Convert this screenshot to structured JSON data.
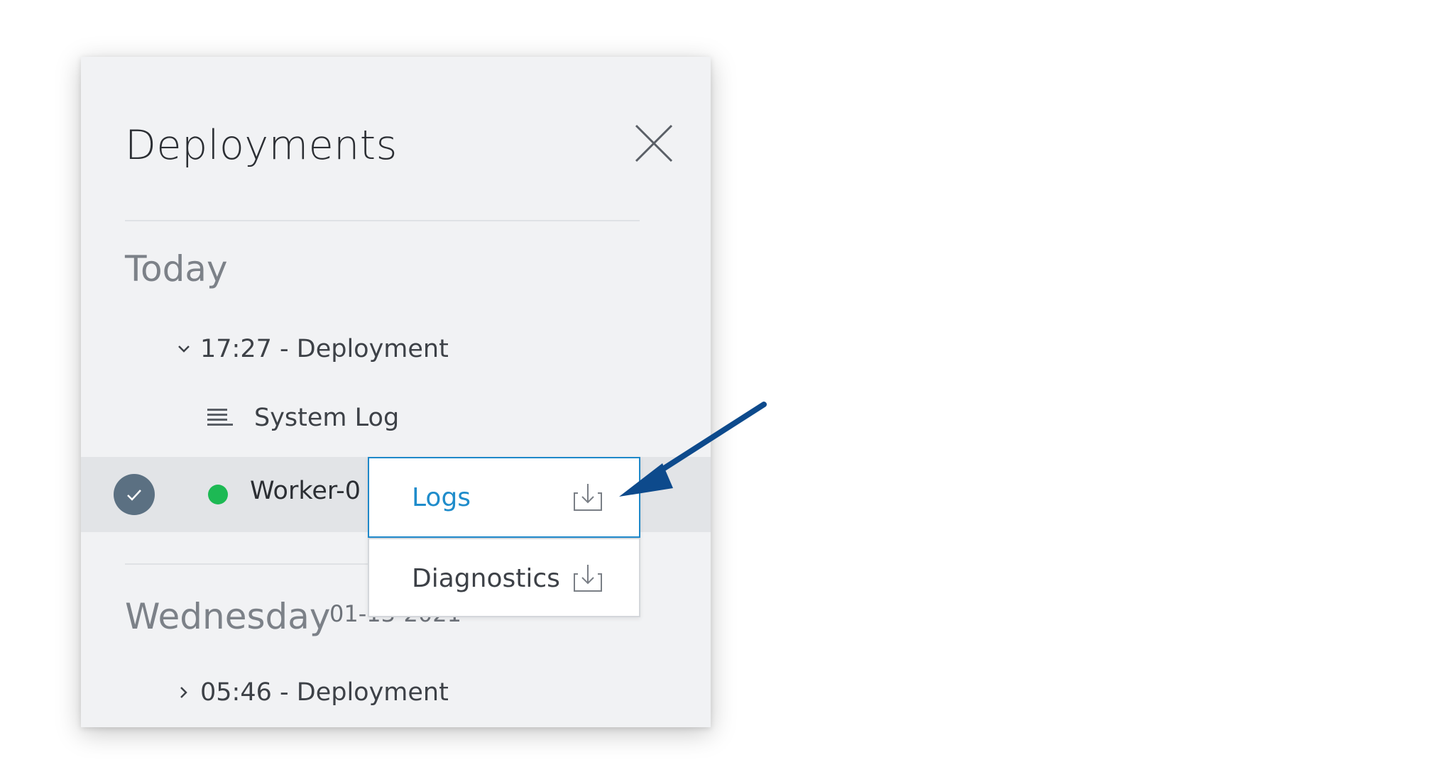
{
  "panel": {
    "title": "Deployments",
    "close_icon": "close-icon"
  },
  "sections": {
    "today": {
      "label": "Today",
      "deployment_label": "17:27 - Deployment",
      "deployment_icon": "chevron-down-icon",
      "system_log_label": "System Log",
      "system_log_icon": "lines-icon",
      "worker": {
        "label": "Worker-0",
        "status_color": "#1db954",
        "check_icon": "check-icon"
      }
    },
    "wednesday": {
      "label": "Wednesday",
      "date": "01-13-2021",
      "deployment_label": "05:46 - Deployment",
      "deployment_icon": "chevron-right-icon"
    }
  },
  "dropdown": {
    "items": [
      {
        "label": "Logs",
        "icon": "download-icon"
      },
      {
        "label": "Diagnostics",
        "icon": "download-icon"
      }
    ]
  },
  "colors": {
    "accent": "#1f8ccb",
    "annotation_arrow": "#0d4a8c"
  }
}
